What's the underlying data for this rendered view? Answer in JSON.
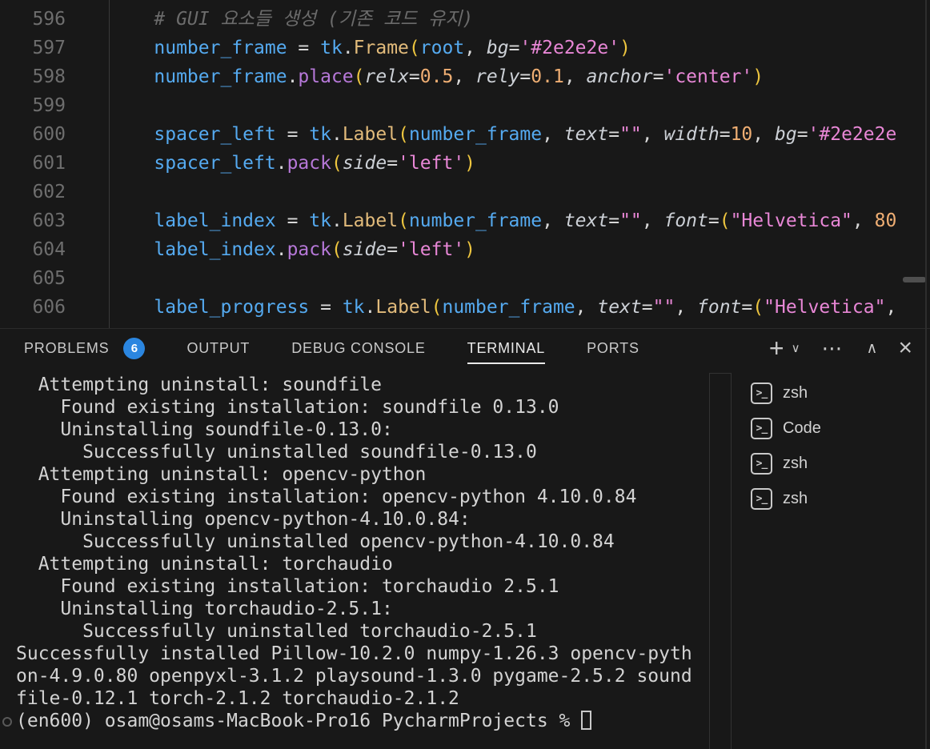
{
  "colors": {
    "background": "#181818",
    "badge_blue": "#2b86e0",
    "variable_blue": "#55aaf0",
    "class_gold": "#e2bb7b",
    "method_purple": "#b678d8",
    "string_pink": "#e887d6",
    "number_orange": "#efae73",
    "bracket_gold": "#edc53f",
    "comment_gray": "#6b6b6b",
    "terminal_text": "#d3d3d3"
  },
  "editor": {
    "lines": [
      {
        "num": "596",
        "tokens": [
          [
            "p",
            "    "
          ],
          [
            "m",
            "# GUI 요소들 생성 (기존 코드 유지)"
          ]
        ]
      },
      {
        "num": "597",
        "tokens": [
          [
            "p",
            "    "
          ],
          [
            "v",
            "number_frame"
          ],
          [
            "p",
            " = "
          ],
          [
            "v",
            "tk"
          ],
          [
            "p",
            "."
          ],
          [
            "c",
            "Frame"
          ],
          [
            "b",
            "("
          ],
          [
            "v",
            "root"
          ],
          [
            "p",
            ", "
          ],
          [
            "i",
            "bg"
          ],
          [
            "p",
            "="
          ],
          [
            "s",
            "'#2e2e2e'"
          ],
          [
            "b",
            ")"
          ]
        ]
      },
      {
        "num": "598",
        "tokens": [
          [
            "p",
            "    "
          ],
          [
            "v",
            "number_frame"
          ],
          [
            "p",
            "."
          ],
          [
            "f",
            "place"
          ],
          [
            "b",
            "("
          ],
          [
            "i",
            "relx"
          ],
          [
            "p",
            "="
          ],
          [
            "n",
            "0.5"
          ],
          [
            "p",
            ", "
          ],
          [
            "i",
            "rely"
          ],
          [
            "p",
            "="
          ],
          [
            "n",
            "0.1"
          ],
          [
            "p",
            ", "
          ],
          [
            "i",
            "anchor"
          ],
          [
            "p",
            "="
          ],
          [
            "s",
            "'center'"
          ],
          [
            "b",
            ")"
          ]
        ]
      },
      {
        "num": "599",
        "tokens": []
      },
      {
        "num": "600",
        "tokens": [
          [
            "p",
            "    "
          ],
          [
            "v",
            "spacer_left"
          ],
          [
            "p",
            " = "
          ],
          [
            "v",
            "tk"
          ],
          [
            "p",
            "."
          ],
          [
            "c",
            "Label"
          ],
          [
            "b",
            "("
          ],
          [
            "v",
            "number_frame"
          ],
          [
            "p",
            ", "
          ],
          [
            "i",
            "text"
          ],
          [
            "p",
            "="
          ],
          [
            "s",
            "\"\""
          ],
          [
            "p",
            ", "
          ],
          [
            "i",
            "width"
          ],
          [
            "p",
            "="
          ],
          [
            "n",
            "10"
          ],
          [
            "p",
            ", "
          ],
          [
            "i",
            "bg"
          ],
          [
            "p",
            "="
          ],
          [
            "s",
            "'#2e2e2e"
          ]
        ]
      },
      {
        "num": "601",
        "tokens": [
          [
            "p",
            "    "
          ],
          [
            "v",
            "spacer_left"
          ],
          [
            "p",
            "."
          ],
          [
            "f",
            "pack"
          ],
          [
            "b",
            "("
          ],
          [
            "i",
            "side"
          ],
          [
            "p",
            "="
          ],
          [
            "s",
            "'left'"
          ],
          [
            "b",
            ")"
          ]
        ]
      },
      {
        "num": "602",
        "tokens": []
      },
      {
        "num": "603",
        "tokens": [
          [
            "p",
            "    "
          ],
          [
            "v",
            "label_index"
          ],
          [
            "p",
            " = "
          ],
          [
            "v",
            "tk"
          ],
          [
            "p",
            "."
          ],
          [
            "c",
            "Label"
          ],
          [
            "b",
            "("
          ],
          [
            "v",
            "number_frame"
          ],
          [
            "p",
            ", "
          ],
          [
            "i",
            "text"
          ],
          [
            "p",
            "="
          ],
          [
            "s",
            "\"\""
          ],
          [
            "p",
            ", "
          ],
          [
            "i",
            "font"
          ],
          [
            "p",
            "="
          ],
          [
            "b",
            "("
          ],
          [
            "s",
            "\"Helvetica\""
          ],
          [
            "p",
            ", "
          ],
          [
            "n",
            "80"
          ]
        ]
      },
      {
        "num": "604",
        "tokens": [
          [
            "p",
            "    "
          ],
          [
            "v",
            "label_index"
          ],
          [
            "p",
            "."
          ],
          [
            "f",
            "pack"
          ],
          [
            "b",
            "("
          ],
          [
            "i",
            "side"
          ],
          [
            "p",
            "="
          ],
          [
            "s",
            "'left'"
          ],
          [
            "b",
            ")"
          ]
        ]
      },
      {
        "num": "605",
        "tokens": []
      },
      {
        "num": "606",
        "tokens": [
          [
            "p",
            "    "
          ],
          [
            "v",
            "label_progress"
          ],
          [
            "p",
            " = "
          ],
          [
            "v",
            "tk"
          ],
          [
            "p",
            "."
          ],
          [
            "c",
            "Label"
          ],
          [
            "b",
            "("
          ],
          [
            "v",
            "number_frame"
          ],
          [
            "p",
            ", "
          ],
          [
            "i",
            "text"
          ],
          [
            "p",
            "="
          ],
          [
            "s",
            "\"\""
          ],
          [
            "p",
            ", "
          ],
          [
            "i",
            "font"
          ],
          [
            "p",
            "="
          ],
          [
            "b",
            "("
          ],
          [
            "s",
            "\"Helvetica\""
          ],
          [
            "p",
            ","
          ]
        ]
      }
    ]
  },
  "panel": {
    "tabs": [
      {
        "label": "PROBLEMS",
        "badge": "6",
        "active": false
      },
      {
        "label": "OUTPUT",
        "active": false
      },
      {
        "label": "DEBUG CONSOLE",
        "active": false
      },
      {
        "label": "TERMINAL",
        "active": true
      },
      {
        "label": "PORTS",
        "active": false
      }
    ],
    "actions": [
      {
        "name": "new-terminal-button",
        "glyph": "+"
      },
      {
        "name": "launch-profile-dropdown",
        "glyph": "∨"
      },
      {
        "name": "more-actions-button",
        "glyph": "⋯"
      },
      {
        "name": "maximize-panel-button",
        "glyph": "∧"
      },
      {
        "name": "close-panel-button",
        "glyph": "×"
      }
    ]
  },
  "terminal": {
    "output_lines": [
      "  Attempting uninstall: soundfile",
      "    Found existing installation: soundfile 0.13.0",
      "    Uninstalling soundfile-0.13.0:",
      "      Successfully uninstalled soundfile-0.13.0",
      "  Attempting uninstall: opencv-python",
      "    Found existing installation: opencv-python 4.10.0.84",
      "    Uninstalling opencv-python-4.10.0.84:",
      "      Successfully uninstalled opencv-python-4.10.0.84",
      "  Attempting uninstall: torchaudio",
      "    Found existing installation: torchaudio 2.5.1",
      "    Uninstalling torchaudio-2.5.1:",
      "      Successfully uninstalled torchaudio-2.5.1",
      "Successfully installed Pillow-10.2.0 numpy-1.26.3 opencv-pyth",
      "on-4.9.0.80 openpyxl-3.1.2 playsound-1.3.0 pygame-2.5.2 sound",
      "file-0.12.1 torch-2.1.2 torchaudio-2.1.2"
    ],
    "prompt": {
      "text": "(en600) osam@osams-MacBook-Pro16 PycharmProjects % "
    }
  },
  "terminal_list": [
    {
      "label": "zsh"
    },
    {
      "label": "Code"
    },
    {
      "label": "zsh"
    },
    {
      "label": "zsh"
    }
  ]
}
